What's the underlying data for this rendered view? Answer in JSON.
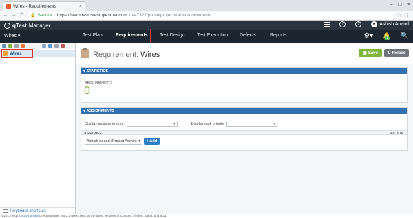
{
  "browser": {
    "tab_title": "Wires - Requirements",
    "tab_close": "×",
    "back": "←",
    "forward": "→",
    "refresh": "C",
    "secure_label": "Secure",
    "url_host": "https://learnbasicstest.qtestnet.com",
    "url_path": "/p/47327/portal/project#tab=requirements",
    "window_controls": [
      "–",
      "□",
      "×"
    ]
  },
  "app": {
    "logo_q": "qTest",
    "logo_name": "Manager",
    "user_name": "Ashish Anand",
    "notification_count": "1"
  },
  "nav": {
    "project": "Wires ▾",
    "tabs": [
      {
        "label": "Test Plan"
      },
      {
        "label": "Requirements"
      },
      {
        "label": "Test Design"
      },
      {
        "label": "Test Execution"
      },
      {
        "label": "Defects"
      },
      {
        "label": "Reports"
      }
    ],
    "active_tab": "Requirements"
  },
  "tree": {
    "root_label": "Wires",
    "shortcuts_label": "Keyboard shortcuts"
  },
  "page": {
    "title_prefix": "Requirement:",
    "title_name": "Wires",
    "save_label": "Save",
    "reload_label": "Reload"
  },
  "statistics": {
    "header": "STATISTICS",
    "label": "REQUIREMENTS",
    "value": "0"
  },
  "assignments": {
    "header": "ASSIGNMENTS",
    "display_assignments_label": "Display assignments of",
    "display_priority_label": "Display task priority",
    "col_assignee": "ASSIGNEE",
    "col_action": "ACTION",
    "assignee_value": "Ashish Anand (Project Admin)",
    "add_label": "+ Add"
  },
  "footer": {
    "copyright": "©2013-2017",
    "brand": "QASymphony",
    "rest": " qTest Manager 8.5.3.2 works best on the latest versions of Chrome, Firefox, Safari, and IE11"
  },
  "colors": {
    "header_dark": "#29343f",
    "nav_dark": "#1c2630",
    "section_blue": "#2f6fb0",
    "save_green": "#7fb53b",
    "highlight_red": "#e03131"
  }
}
